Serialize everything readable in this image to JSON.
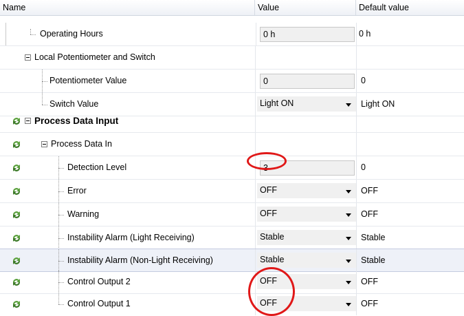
{
  "header": {
    "name": "Name",
    "value": "Value",
    "default": "Default value"
  },
  "rows": [
    {
      "name": "Operating Hours",
      "value": "0 h",
      "default": "0 h"
    },
    {
      "name": "Local Potentiometer and Switch",
      "value": "",
      "default": ""
    },
    {
      "name": "Potentiometer Value",
      "value": "0",
      "default": "0"
    },
    {
      "name": "Switch Value",
      "value": "Light ON",
      "default": "Light ON"
    },
    {
      "name": "Process Data Input",
      "value": "",
      "default": ""
    },
    {
      "name": "Process Data In",
      "value": "",
      "default": ""
    },
    {
      "name": "Detection Level",
      "value": "3",
      "default": "0"
    },
    {
      "name": "Error",
      "value": "OFF",
      "default": "OFF"
    },
    {
      "name": "Warning",
      "value": "OFF",
      "default": "OFF"
    },
    {
      "name": "Instability Alarm (Light Receiving)",
      "value": "Stable",
      "default": "Stable"
    },
    {
      "name": "Instability Alarm (Non-Light Receiving)",
      "value": "Stable",
      "default": "Stable"
    },
    {
      "name": "Control Output 2",
      "value": "OFF",
      "default": "OFF"
    },
    {
      "name": "Control Output 1",
      "value": "OFF",
      "default": "OFF"
    }
  ],
  "icons": {
    "expand": "collapse-minus-icon",
    "sync": "sync-arrows-icon",
    "dropdown": "dropdown-arrow-icon"
  },
  "colors": {
    "highlight_circle": "#e01818",
    "sync_icon": "#5aa03c",
    "selected_row": "#eef1f8"
  }
}
